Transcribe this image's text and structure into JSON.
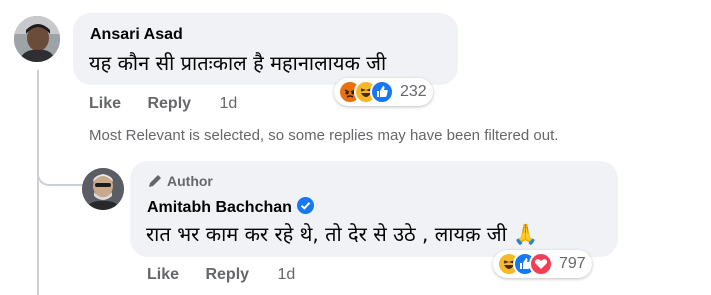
{
  "comment": {
    "author": "Ansari Asad",
    "text": "यह कौन सी प्रातःकाल है महानालायक जी",
    "like_label": "Like",
    "reply_label": "Reply",
    "time": "1d",
    "reaction_count": "232",
    "reactions": [
      "angry",
      "haha",
      "like"
    ]
  },
  "notice": "Most Relevant is selected, so some replies may have been filtered out.",
  "reply": {
    "author_tag": "Author",
    "author": "Amitabh Bachchan",
    "text": "रात भर काम कर रहे थे, तो देर से उठे , लायक़ जी 🙏",
    "like_label": "Like",
    "reply_label": "Reply",
    "time": "1d",
    "reaction_count": "797",
    "reactions": [
      "haha",
      "like",
      "love"
    ]
  },
  "colors": {
    "bubble": "#f0f2f5",
    "meta": "#65676b",
    "like_blue": "#1877f2",
    "love_red": "#f33e58",
    "haha_yellow": "#f7b928",
    "angry_orange": "#e9710f"
  }
}
